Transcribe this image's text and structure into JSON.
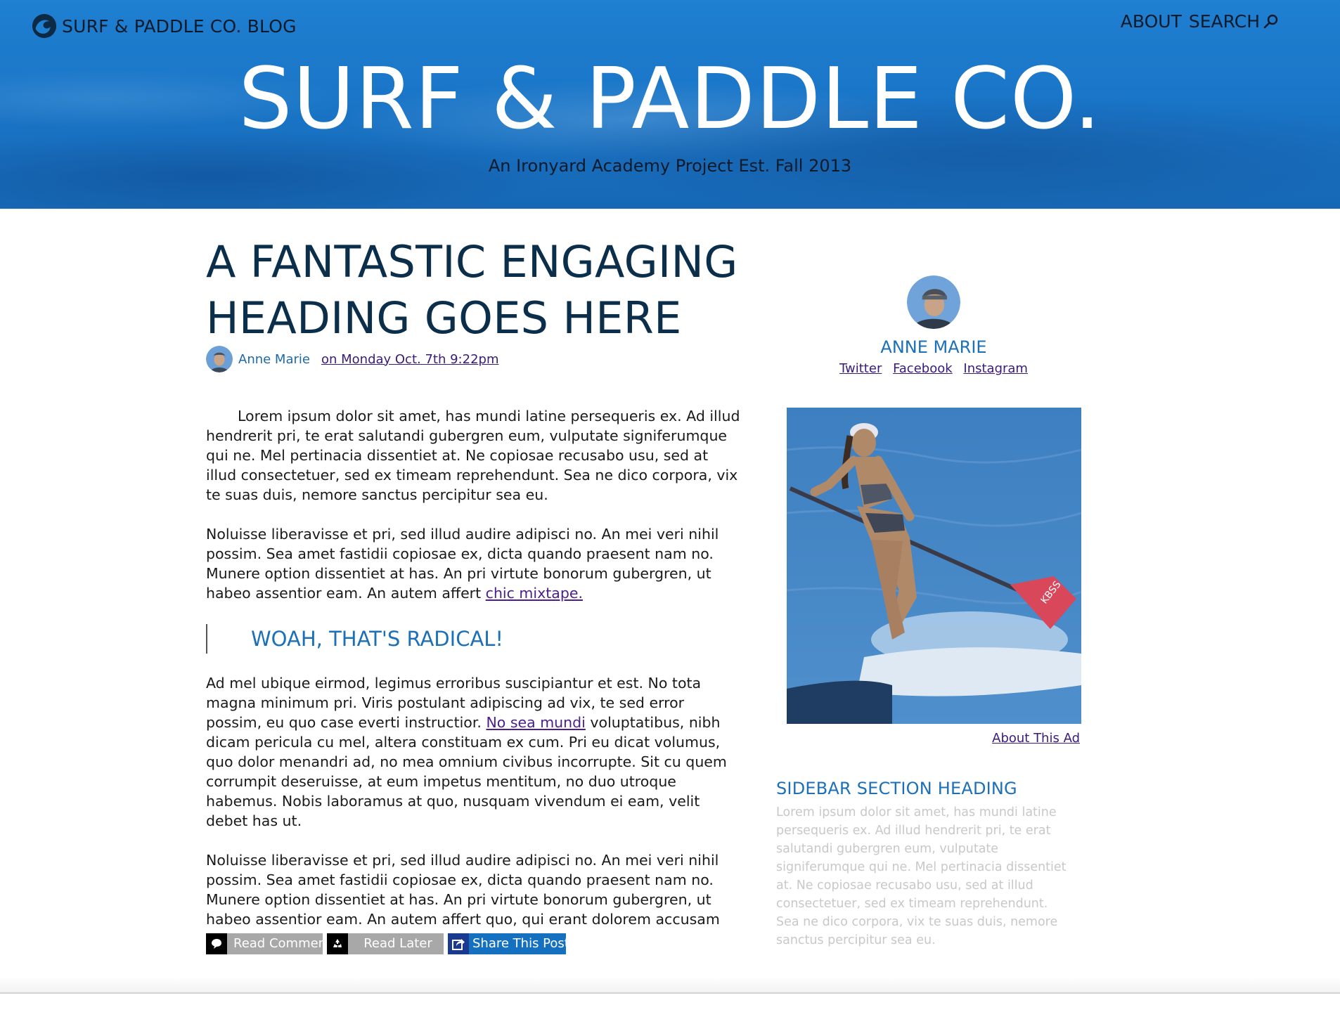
{
  "header": {
    "brand": "SURF & PADDLE CO. BLOG",
    "nav": {
      "about": "ABOUT",
      "search": "SEARCH"
    },
    "title": "SURF & PADDLE CO.",
    "tagline": "An Ironyard Academy Project Est. Fall 2013"
  },
  "post": {
    "heading": "A FANTASTIC ENGAGING HEADING GOES HERE",
    "author": "Anne Marie",
    "date": "on Monday Oct. 7th 9:22pm",
    "p1": "Lorem ipsum dolor sit amet, has mundi latine persequeris ex. Ad illud hendrerit pri, te erat salutandi gubergren eum, vulputate signiferumque qui ne. Mel pertinacia dissentiet at. Ne copiosae recusabo usu, sed at illud consectetuer, sed ex timeam reprehendunt. Sea ne dico corpora, vix te suas duis, nemore sanctus percipitur sea eu.",
    "p2_text": "Noluisse liberavisse et pri, sed illud audire adipisci no. An mei veri nihil possim. Sea amet fastidii copiosae ex, dicta quando praesent nam no. Munere option dissentiet at has. An pri virtute bonorum gubergren, ut habeo assentior eam. An autem affert ",
    "p2_link": "chic mixtape.",
    "pullquote": "WOAH, THAT'S RADICAL!",
    "p3_before": "Ad mel ubique eirmod, legimus erroribus suscipiantur et est. No tota magna minimum pri. Viris postulant adipiscing ad vix, te sed error possim, eu quo case everti instructior. ",
    "p3_link": "No sea mundi",
    "p3_after": " voluptatibus, nibh dicam pericula cu mel, altera constituam ex cum. Pri eu dicat volumus, quo dolor menandri ad, no mea omnium civibus incorrupte. Sit cu quem corrumpit deseruisse, at eum impetus mentitum, no duo utroque habemus. Nobis laboramus at quo, nusquam vivendum ei eam, velit debet has ut.",
    "p4": "Noluisse liberavisse et pri, sed illud audire adipisci no. An mei veri nihil possim. Sea amet fastidii copiosae ex, dicta quando praesent nam no. Munere option dissentiet at has. An pri virtute bonorum gubergren, ut habeo assentior eam. An autem affert quo, qui erant dolorem accusam an.",
    "actions": {
      "comment": "Read Comment",
      "later": "Read Later",
      "share": "Share This Post"
    }
  },
  "sidebar": {
    "profile_name": "ANNE MARIE",
    "links": {
      "twitter": "Twitter",
      "facebook": "Facebook",
      "instagram": "Instagram"
    },
    "ad_caption": "About This Ad",
    "ad_board_text": "KBSS",
    "section_heading": "SIDEBAR SECTION HEADING",
    "section_text": "Lorem ipsum dolor sit amet, has mundi latine persequeris ex. Ad illud hendrerit pri, te erat salutandi gubergren eum, vulputate signiferumque qui ne. Mel pertinacia dissentiet at. Ne copiosae recusabo usu, sed at illud consectetuer, sed ex timeam reprehendunt. Sea ne dico corpora, vix te suas duis, nemore sanctus percipitur sea eu."
  },
  "colors": {
    "header_blue": "#1a76c8",
    "heading_navy": "#0b2e4b",
    "accent_blue": "#1c70b8",
    "link_purple": "#4b1e8a",
    "share_blue": "#1670c0"
  },
  "icons": {
    "brand": "wave-logo-icon",
    "search": "search-icon",
    "comment": "speech-bubble-icon",
    "later": "recycle-icon",
    "share": "share-arrow-icon"
  }
}
